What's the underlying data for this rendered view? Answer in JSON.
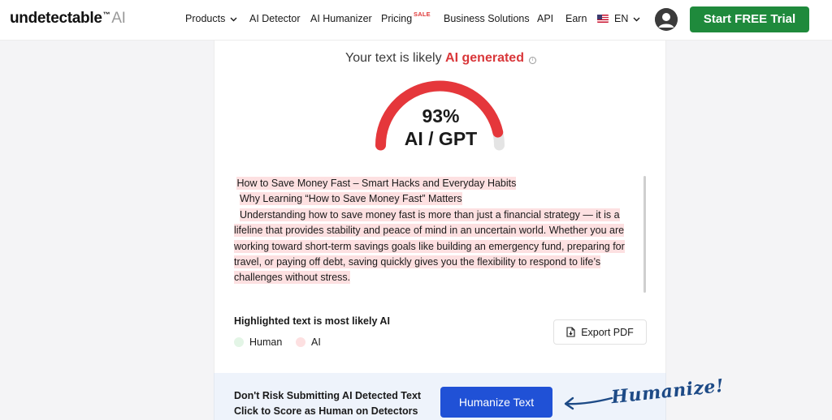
{
  "nav": {
    "logo_main": "undetectable",
    "logo_tm": "™",
    "logo_ai": "AI",
    "items": [
      {
        "label": "Products",
        "has_dropdown": true
      },
      {
        "label": "AI Detector"
      },
      {
        "label": "AI Humanizer"
      },
      {
        "label": "Pricing",
        "badge": "SALE"
      },
      {
        "label": "Business Solutions"
      },
      {
        "label": "API"
      },
      {
        "label": "Earn"
      }
    ],
    "language": "EN",
    "cta_label": "Start FREE Trial"
  },
  "result": {
    "prefix": "Your text is likely ",
    "verdict": "AI generated",
    "info_glyph": "i",
    "percent": "93%",
    "percent_value": 93,
    "label": "AI / GPT"
  },
  "analyzed_text": [
    "How to Save Money Fast – Smart Hacks and Everyday Habits",
    "Why Learning “How to Save Money Fast” Matters",
    "Understanding how to save money fast is more than just a financial strategy — it is a lifeline that provides stability and peace of mind in an uncertain world.  Whether you are working toward short-term savings goals like building an emergency fund, preparing for travel, or paying off debt, saving quickly gives you the flexibility to respond to life’s challenges without stress."
  ],
  "legend": {
    "title": "Highlighted text is most likely AI",
    "human_label": "Human",
    "ai_label": "AI"
  },
  "export_label": "Export PDF",
  "banner": {
    "line1": "Don't Risk Submitting AI Detected Text",
    "line2": "Click to Score as Human on Detectors",
    "button_label": "Humanize Text",
    "annotation": "Humanize!"
  },
  "colors": {
    "accent_green": "#1f8a3c",
    "accent_blue": "#2051d6",
    "ai_red": "#d9373a",
    "ai_highlight": "#fde0e1",
    "human_highlight": "#e3f5e6"
  }
}
